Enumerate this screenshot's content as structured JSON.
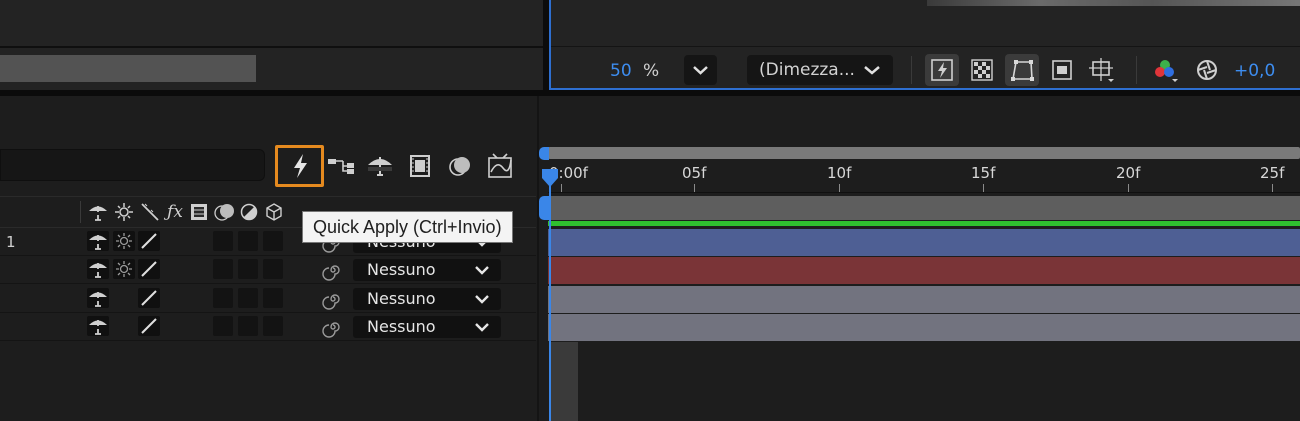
{
  "viewer": {
    "zoom_value": "50",
    "zoom_unit": "%",
    "resolution": "(Dimezza...",
    "exposure": "+0,0"
  },
  "timeline": {
    "ruler_labels": [
      "0:00f",
      "05f",
      "10f",
      "15f",
      "20f",
      "25f"
    ],
    "tooltip": "Quick Apply (Ctrl+Invio)",
    "layers": [
      {
        "index": "1",
        "parent": "Nessuno",
        "color": "#4e5f94"
      },
      {
        "index": "",
        "parent": "Nessuno",
        "color": "#7a3437"
      },
      {
        "index": "",
        "parent": "Nessuno",
        "color": "#72737f"
      },
      {
        "index": "",
        "parent": "Nessuno",
        "color": "#72737f"
      }
    ]
  },
  "colors": {
    "accent_blue": "#3a86e8",
    "highlight_orange": "#e58a1f",
    "work_area_green": "#2fbf2f"
  }
}
